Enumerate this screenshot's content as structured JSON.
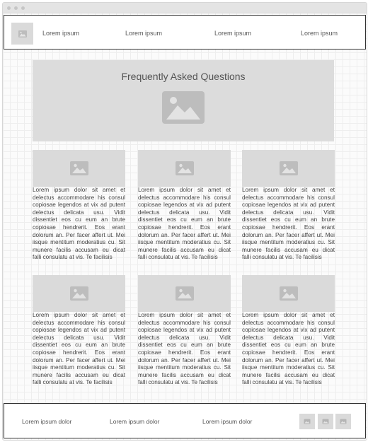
{
  "header": {
    "nav": [
      "Lorem ipsum",
      "Lorem ipsum",
      "Lorem ipsum",
      "Lorem ipsum"
    ],
    "logo_icon": "image-placeholder-icon"
  },
  "hero": {
    "title": "Frequently Asked Questions",
    "icon": "image-placeholder-icon"
  },
  "cards": [
    {
      "text": "Lorem ipsum dolor sit amet et delectus accommodare his consul copiosae legendos at vix ad putent delectus delicata usu. Vidit dissentiet eos cu eum an brute copiosae hendrerit. Eos erant dolorum an. Per facer affert ut. Mei iisque mentitum moderatius cu. Sit munere facilis accusam eu dicat falli consulatu at vis. Te facilisis"
    },
    {
      "text": "Lorem ipsum dolor sit amet et delectus accommodare his consul copiosae legendos at vix ad putent delectus delicata usu. Vidit dissentiet eos cu eum an brute copiosae hendrerit. Eos erant dolorum an. Per facer affert ut. Mei iisque mentitum moderatius cu. Sit munere facilis accusam eu dicat falli consulatu at vis. Te facilisis"
    },
    {
      "text": "Lorem ipsum dolor sit amet et delectus accommodare his consul copiosae legendos at vix ad putent delectus delicata usu. Vidit dissentiet eos cu eum an brute copiosae hendrerit. Eos erant dolorum an. Per facer affert ut. Mei iisque mentitum moderatius cu. Sit munere facilis accusam eu dicat falli consulatu at vis. Te facilisis"
    },
    {
      "text": "Lorem ipsum dolor sit amet et delectus accommodare his consul copiosae legendos at vix ad putent delectus delicata usu. Vidit dissentiet eos cu eum an brute copiosae hendrerit. Eos erant dolorum an. Per facer affert ut. Mei iisque mentitum moderatius cu. Sit munere facilis accusam eu dicat falli consulatu at vis. Te facilisis"
    },
    {
      "text": "Lorem ipsum dolor sit amet et delectus accommodare his consul copiosae legendos at vix ad putent delectus delicata usu. Vidit dissentiet eos cu eum an brute copiosae hendrerit. Eos erant dolorum an. Per facer affert ut. Mei iisque mentitum moderatius cu. Sit munere facilis accusam eu dicat falli consulatu at vis. Te facilisis"
    },
    {
      "text": "Lorem ipsum dolor sit amet et delectus accommodare his consul copiosae legendos at vix ad putent delectus delicata usu. Vidit dissentiet eos cu eum an brute copiosae hendrerit. Eos erant dolorum an. Per facer affert ut. Mei iisque mentitum moderatius cu. Sit munere facilis accusam eu dicat falli consulatu at vis. Te facilisis"
    }
  ],
  "footer": {
    "links": [
      "Lorem ipsum dolor",
      "Lorem ipsum dolor",
      "Lorem ipsum dolor"
    ],
    "social_icons": [
      "image-placeholder-icon",
      "image-placeholder-icon",
      "image-placeholder-icon"
    ]
  },
  "colors": {
    "placeholder_fill": "#dadada",
    "placeholder_glyph": "#bdbdbd",
    "border": "#333333",
    "grid_line": "#eeeeee"
  }
}
